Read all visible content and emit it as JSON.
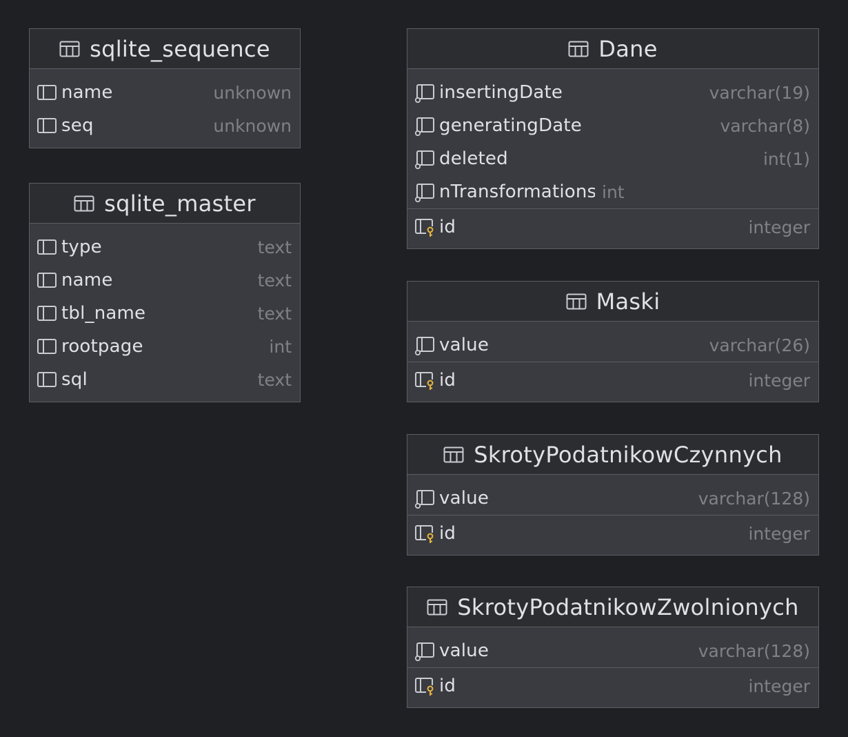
{
  "tables": [
    {
      "name": "sqlite_sequence",
      "columns": [
        {
          "name": "name",
          "type": "unknown"
        },
        {
          "name": "seq",
          "type": "unknown"
        }
      ],
      "keys": []
    },
    {
      "name": "sqlite_master",
      "columns": [
        {
          "name": "type",
          "type": "text"
        },
        {
          "name": "name",
          "type": "text"
        },
        {
          "name": "tbl_name",
          "type": "text"
        },
        {
          "name": "rootpage",
          "type": "int"
        },
        {
          "name": "sql",
          "type": "text"
        }
      ],
      "keys": []
    },
    {
      "name": "Dane",
      "columns": [
        {
          "name": "insertingDate",
          "type": "varchar(19)"
        },
        {
          "name": "generatingDate",
          "type": "varchar(8)"
        },
        {
          "name": "deleted",
          "type": "int(1)"
        },
        {
          "name": "nTransformations",
          "type": "int"
        }
      ],
      "keys": [
        {
          "name": "id",
          "type": "integer"
        }
      ]
    },
    {
      "name": "Maski",
      "columns": [
        {
          "name": "value",
          "type": "varchar(26)"
        }
      ],
      "keys": [
        {
          "name": "id",
          "type": "integer"
        }
      ]
    },
    {
      "name": "SkrotyPodatnikowCzynnych",
      "columns": [
        {
          "name": "value",
          "type": "varchar(128)"
        }
      ],
      "keys": [
        {
          "name": "id",
          "type": "integer"
        }
      ]
    },
    {
      "name": "SkrotyPodatnikowZwolnionych",
      "columns": [
        {
          "name": "value",
          "type": "varchar(128)"
        }
      ],
      "keys": [
        {
          "name": "id",
          "type": "integer"
        }
      ]
    }
  ],
  "colors": {
    "background": "#1f2023",
    "table_body": "#393b40",
    "table_header": "#2b2d30",
    "border": "#5a5d63",
    "text": "#dfe1e5",
    "type_text": "#7e8187",
    "key_icon": "#e8b53e"
  }
}
